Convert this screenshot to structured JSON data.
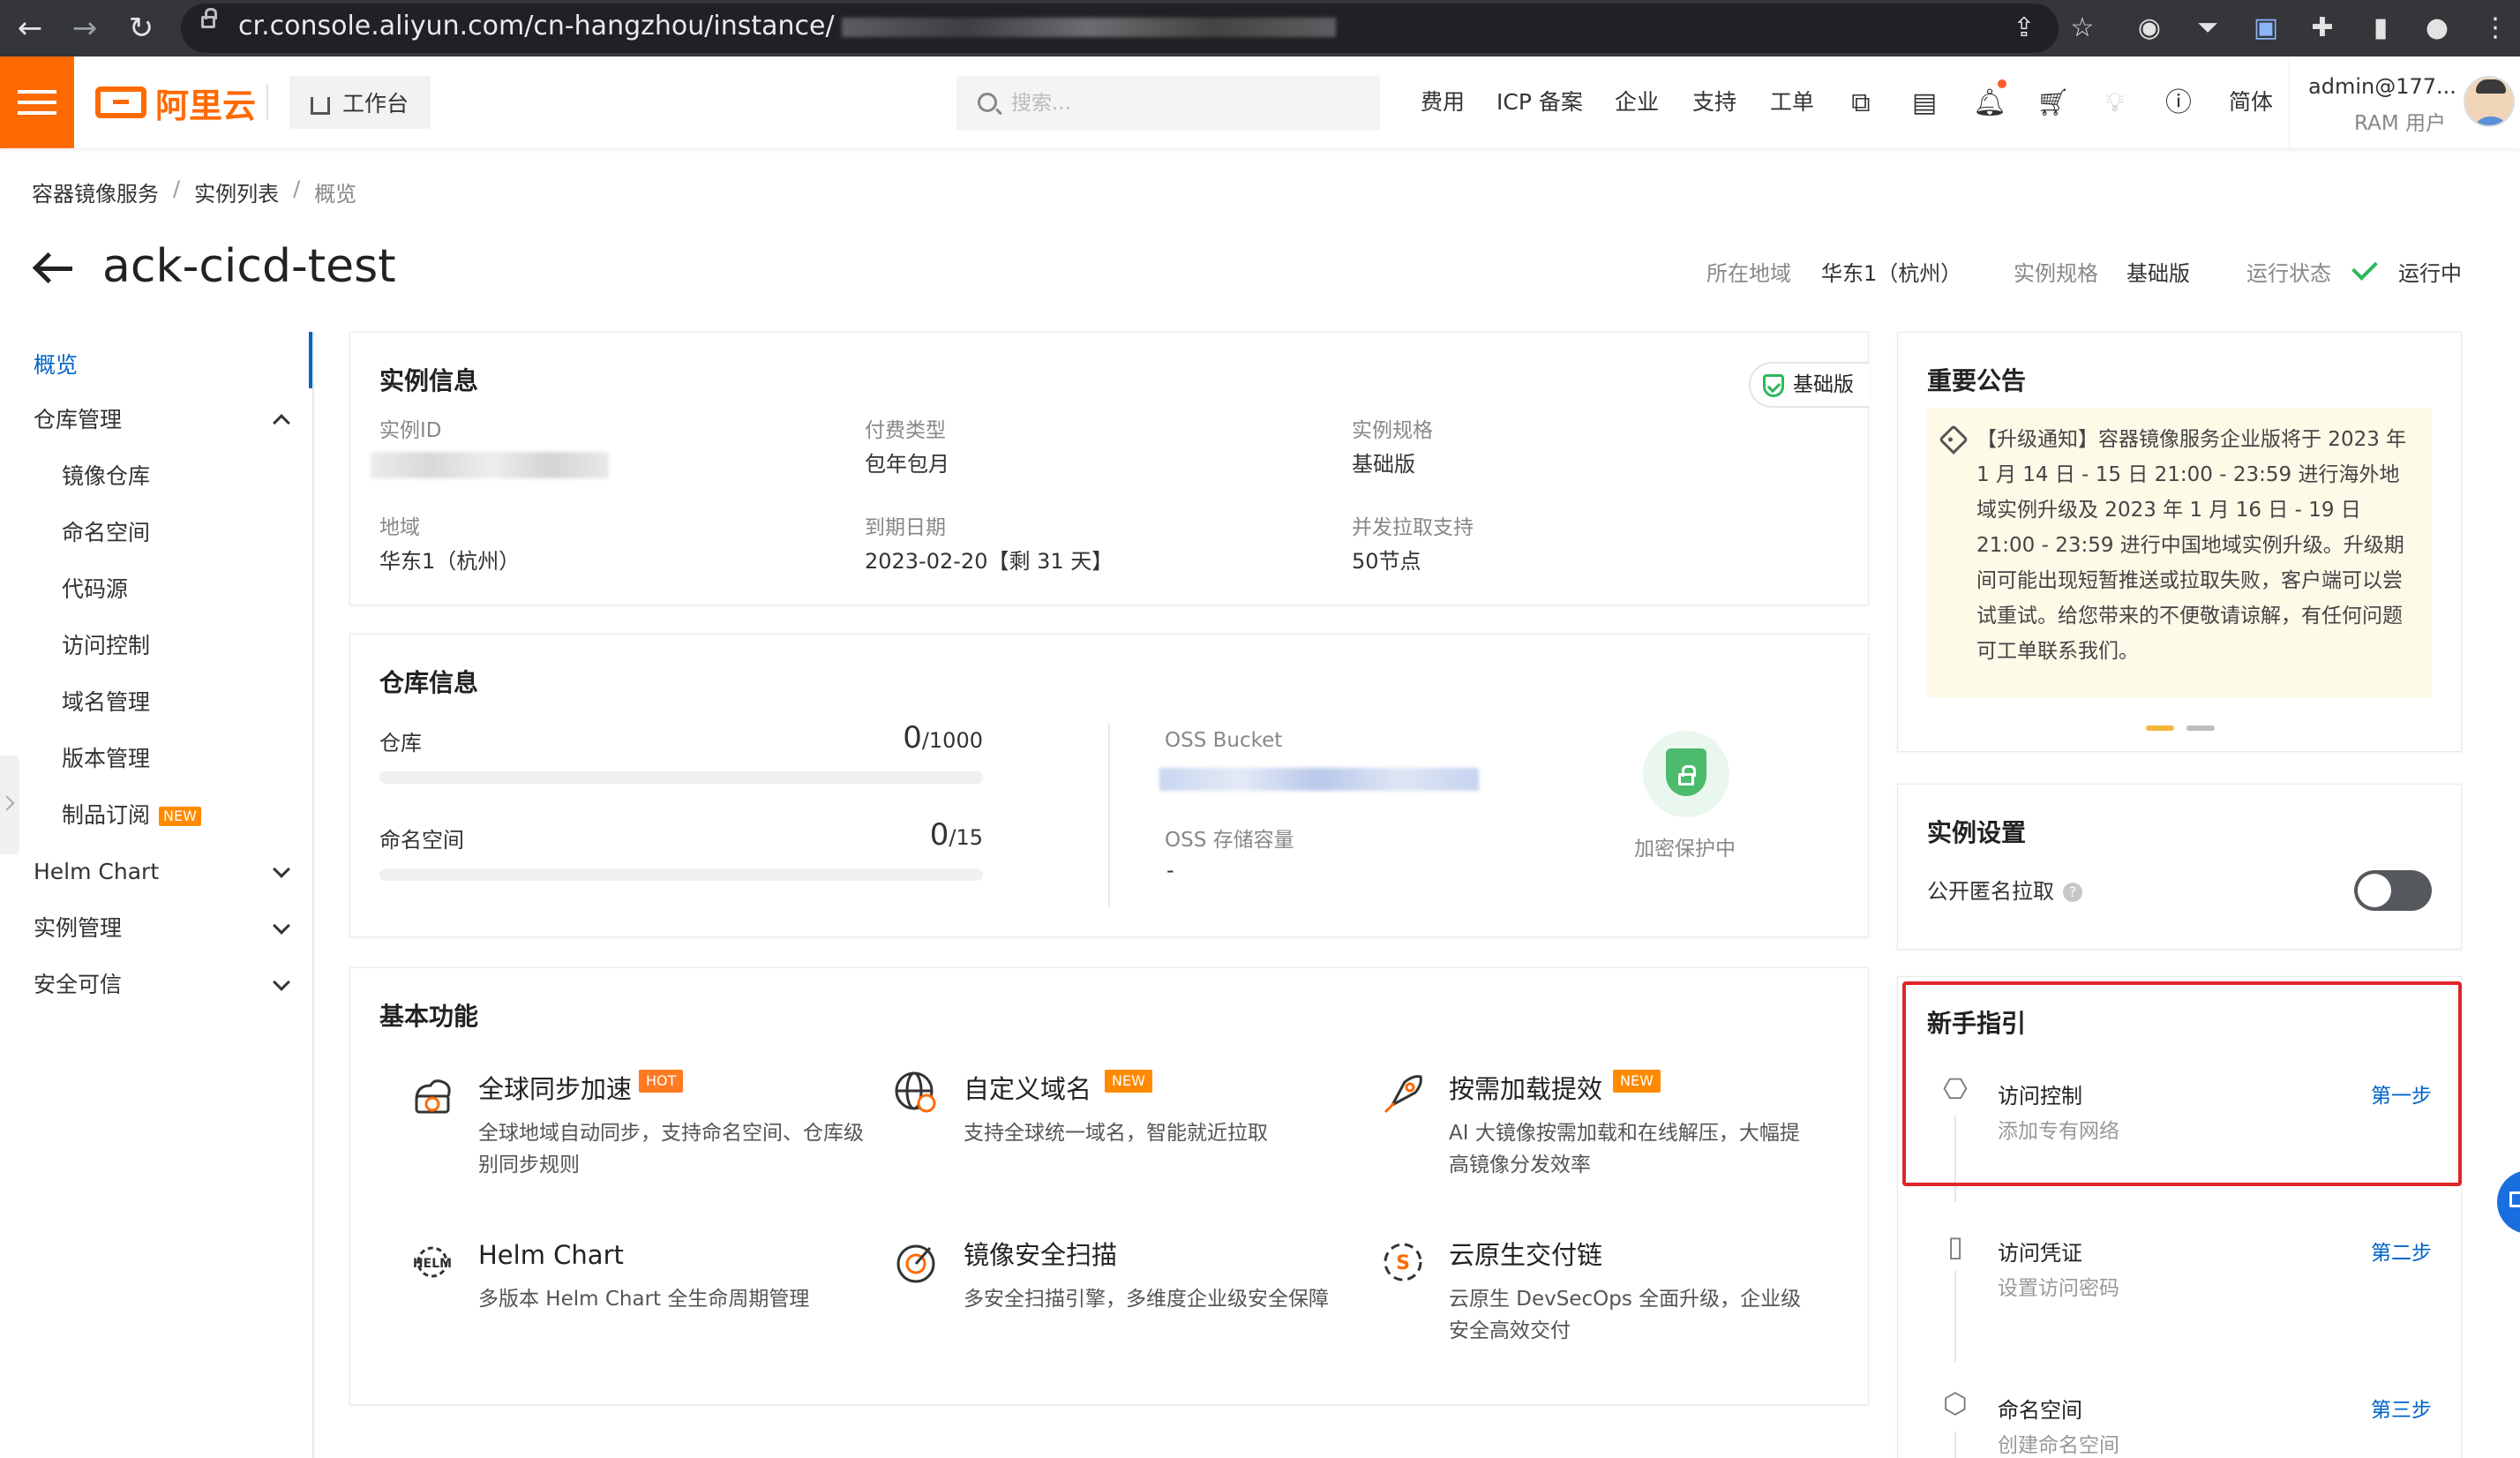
{
  "browser": {
    "url_visible": "cr.console.aliyun.com/cn-hangzhou/instance/",
    "icons": [
      "back-arrow-icon",
      "forward-arrow-icon",
      "reload-icon",
      "lock-icon",
      "share-icon",
      "bookmark-star-icon",
      "1password-icon",
      "filter-extension-icon",
      "extension-icon",
      "puzzle-extensions-icon",
      "sidebar-icon",
      "profile-icon",
      "kebab-menu-icon"
    ]
  },
  "topnav": {
    "logo_text": "阿里云",
    "workbench": "工作台",
    "search_placeholder": "搜索...",
    "links": [
      "费用",
      "ICP 备案",
      "企业",
      "支持",
      "工单"
    ],
    "icons": [
      "app-icon",
      "terminal-icon",
      "bell-icon",
      "cart-icon",
      "bulb-icon",
      "help-icon"
    ],
    "lang": "简体",
    "user_name": "admin@177...",
    "user_role": "RAM 用户",
    "accent": "#ff6a00"
  },
  "breadcrumb": [
    "容器镜像服务",
    "实例列表",
    "概览"
  ],
  "page": {
    "title": "ack-cicd-test",
    "region_label": "所在地域",
    "region_value": "华东1（杭州）",
    "spec_label": "实例规格",
    "spec_value": "基础版",
    "status_label": "运行状态",
    "status_value": "运行中",
    "status_color": "#2eb85c"
  },
  "sidebar": {
    "overview": "概览",
    "repo_mgmt": "仓库管理",
    "repo_items": [
      "镜像仓库",
      "命名空间",
      "代码源",
      "访问控制",
      "域名管理",
      "版本管理",
      "制品订阅"
    ],
    "new_badge": "NEW",
    "groups": [
      "Helm Chart",
      "实例管理",
      "安全可信"
    ],
    "active_color": "#0064c8"
  },
  "instance_info": {
    "title": "实例信息",
    "badge": "基础版",
    "fields": [
      {
        "label": "实例ID",
        "value": ""
      },
      {
        "label": "付费类型",
        "value": "包年包月"
      },
      {
        "label": "实例规格",
        "value": "基础版"
      },
      {
        "label": "地域",
        "value": "华东1（杭州）"
      },
      {
        "label": "到期日期",
        "value": "2023-02-20【剩 31 天】"
      },
      {
        "label": "并发拉取支持",
        "value": "50节点"
      }
    ]
  },
  "repo_info": {
    "title": "仓库信息",
    "repo_label": "仓库",
    "repo_used": "0",
    "repo_total": "/1000",
    "repo_progress": 0,
    "ns_label": "命名空间",
    "ns_used": "0",
    "ns_total": "/15",
    "ns_progress": 0,
    "oss_bucket_label": "OSS Bucket",
    "oss_capacity_label": "OSS 存储容量",
    "oss_capacity_value": "-",
    "encryption_label": "加密保护中"
  },
  "features": {
    "title": "基本功能",
    "items": [
      {
        "title": "全球同步加速",
        "tag": "HOT",
        "desc": "全球地域自动同步，支持命名空间、仓库级别同步规则",
        "icon": "global-sync-icon"
      },
      {
        "title": "自定义域名",
        "tag": "NEW",
        "desc": "支持全球统一域名，智能就近拉取",
        "icon": "custom-domain-icon"
      },
      {
        "title": "按需加载提效",
        "tag": "NEW",
        "desc": "AI 大镜像按需加载和在线解压，大幅提高镜像分发效率",
        "icon": "rocket-icon"
      },
      {
        "title": "Helm Chart",
        "tag": "",
        "desc": "多版本 Helm Chart 全生命周期管理",
        "icon": "helm-icon"
      },
      {
        "title": "镜像安全扫描",
        "tag": "",
        "desc": "多安全扫描引擎，多维度企业级安全保障",
        "icon": "security-scan-icon"
      },
      {
        "title": "云原生交付链",
        "tag": "",
        "desc": "云原生 DevSecOps 全面升级，企业级安全高效交付",
        "icon": "delivery-chain-icon"
      }
    ]
  },
  "announcement": {
    "title": "重要公告",
    "text": "【升级通知】容器镜像服务企业版将于 2023 年 1 月 14 日 - 15 日 21:00 - 23:59 进行海外地域实例升级及 2023 年 1 月 16 日 - 19 日 21:00 - 23:59 进行中国地域实例升级。升级期间可能出现短暂推送或拉取失败，客户端可以尝试重试。给您带来的不便敬请谅解，有任何问题可工单联系我们。",
    "indicator_active": "#f5b63c",
    "indicator_inactive": "#bdbdbd"
  },
  "settings": {
    "title": "实例设置",
    "public_pull_label": "公开匿名拉取",
    "public_pull_enabled": false
  },
  "guide": {
    "title": "新手指引",
    "steps": [
      {
        "title": "访问控制",
        "sub": "添加专有网络",
        "step": "第一步",
        "icon": "access-control-icon"
      },
      {
        "title": "访问凭证",
        "sub": "设置访问密码",
        "step": "第二步",
        "icon": "credential-icon"
      },
      {
        "title": "命名空间",
        "sub": "创建命名空间",
        "step": "第三步",
        "icon": "namespace-icon"
      }
    ],
    "highlight_color": "#e0252b"
  }
}
